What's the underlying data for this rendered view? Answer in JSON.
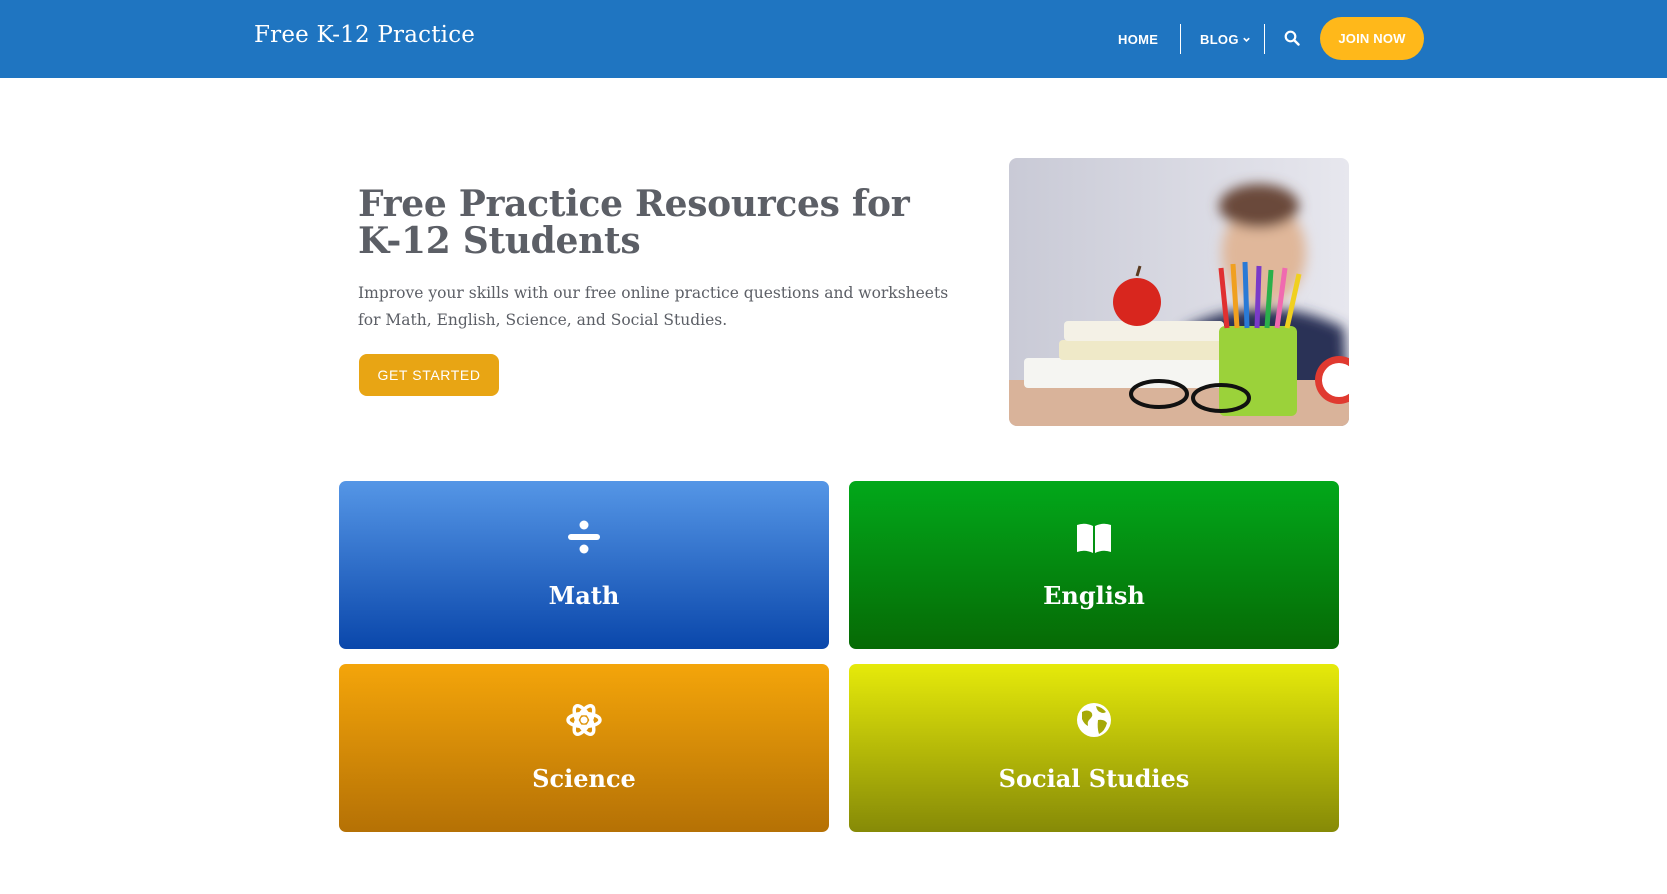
{
  "header": {
    "brand": "Free K-12 Practice",
    "nav": {
      "home": "HOME",
      "blog": "BLOG"
    },
    "join_label": "JOIN NOW",
    "colors": {
      "bar": "#1f75c1",
      "join": "#ffb81a"
    }
  },
  "hero": {
    "title": "Free Practice Resources for K-12 Students",
    "description": "Improve your skills with our free online practice questions and worksheets for Math, English, Science, and Social Studies.",
    "cta_label": "GET STARTED",
    "photo_icon": "classroom-photo"
  },
  "subjects": [
    {
      "label": "Math",
      "icon": "divide-icon",
      "color": "#1f66c9"
    },
    {
      "label": "English",
      "icon": "open-book-icon",
      "color": "#04910f"
    },
    {
      "label": "Science",
      "icon": "atom-icon",
      "color": "#d88b08"
    },
    {
      "label": "Social Studies",
      "icon": "globe-icon",
      "color": "#b7bb09"
    }
  ]
}
